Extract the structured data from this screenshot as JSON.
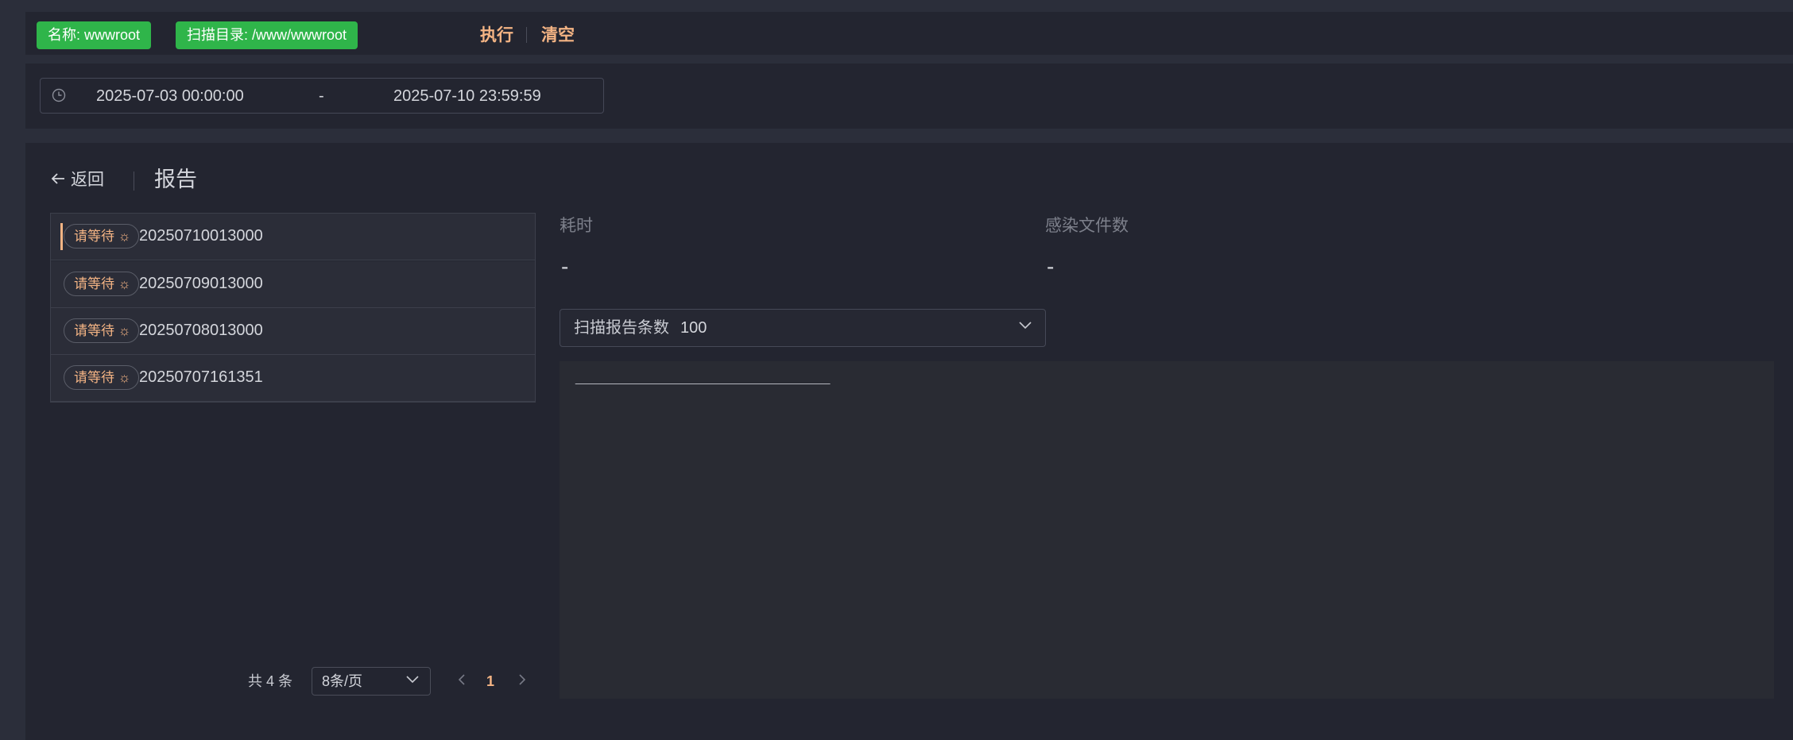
{
  "header": {
    "name_tag": "名称: wwwroot",
    "dir_tag": "扫描目录: /www/wwwroot",
    "execute_label": "执行",
    "clear_label": "清空"
  },
  "date_range": {
    "start": "2025-07-03 00:00:00",
    "separator": "-",
    "end": "2025-07-10 23:59:59",
    "icon": "clock-icon"
  },
  "report": {
    "back_label": "返回",
    "title": "报告",
    "items": [
      {
        "status": "请等待",
        "id": "20250710013000",
        "active": true
      },
      {
        "status": "请等待",
        "id": "20250709013000",
        "active": false
      },
      {
        "status": "请等待",
        "id": "20250708013000",
        "active": false
      },
      {
        "status": "请等待",
        "id": "20250707161351",
        "active": false
      }
    ],
    "pagination": {
      "total": "共 4 条",
      "page_size": "8条/页",
      "current_page": "1"
    },
    "stats": {
      "duration_label": "耗时",
      "duration_value": "-",
      "infected_label": "感染文件数",
      "infected_value": "-"
    },
    "count_select": {
      "label": "扫描报告条数",
      "value": "100"
    },
    "output_line": "____________________________________"
  },
  "colors": {
    "accent": "#f4b484",
    "tag_green": "#2fb54a",
    "panel_bg": "#232530",
    "page_bg": "#2b2e3a"
  }
}
